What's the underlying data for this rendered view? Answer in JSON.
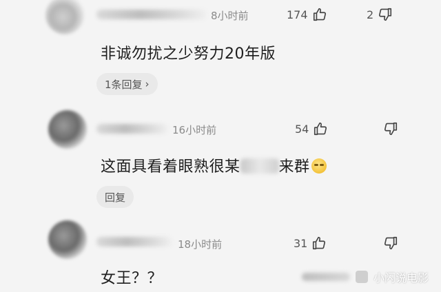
{
  "comments": [
    {
      "time": "8小时前",
      "likes": "174",
      "dislikes": "2",
      "text": "非诚勿扰之少努力20年版",
      "reply_chip": "1条回复",
      "reply_chevron": "›"
    },
    {
      "time": "16小时前",
      "likes": "54",
      "dislikes": "",
      "text_before": "这面具看着眼熟很某",
      "text_after": "来群",
      "emoji": "grinning-face-emoji",
      "reply_chip": "回复"
    },
    {
      "time": "18小时前",
      "likes": "31",
      "dislikes": "",
      "text": "女王？？"
    }
  ],
  "watermark": "小闪说电影",
  "icons": {
    "like": "thumbs-up-icon",
    "dislike": "thumbs-down-icon"
  }
}
